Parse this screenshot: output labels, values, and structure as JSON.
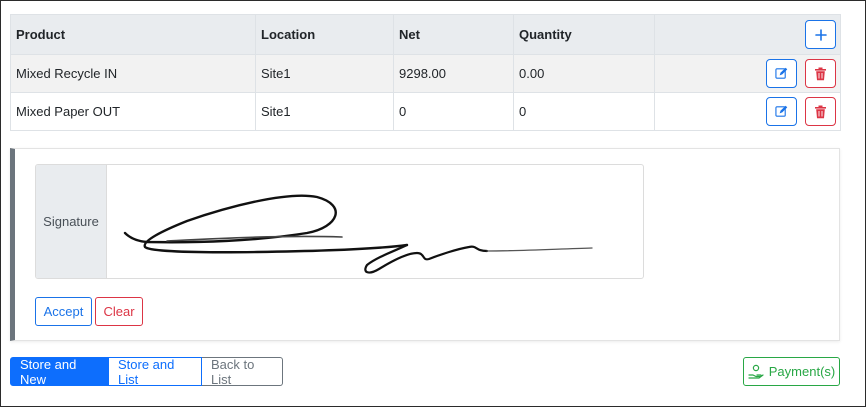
{
  "table": {
    "headers": {
      "product": "Product",
      "location": "Location",
      "net": "Net",
      "quantity": "Quantity"
    },
    "rows": [
      {
        "product": "Mixed Recycle IN",
        "location": "Site1",
        "net": "9298.00",
        "quantity": "0.00"
      },
      {
        "product": "Mixed Paper OUT",
        "location": "Site1",
        "net": "0",
        "quantity": "0"
      }
    ],
    "add_icon": "plus-icon",
    "edit_icon": "pencil-icon",
    "delete_icon": "trash-icon"
  },
  "signature": {
    "label": "Signature",
    "accept_label": "Accept",
    "clear_label": "Clear"
  },
  "footer": {
    "store_new_label": "Store and New",
    "store_list_label": "Store and List",
    "back_label": "Back to List",
    "payment_label": "Payment(s)",
    "payment_icon": "hand-money-icon"
  },
  "colors": {
    "primary": "#0d6efd",
    "danger": "#dc3545",
    "success": "#28a745",
    "secondary": "#6c757d"
  }
}
